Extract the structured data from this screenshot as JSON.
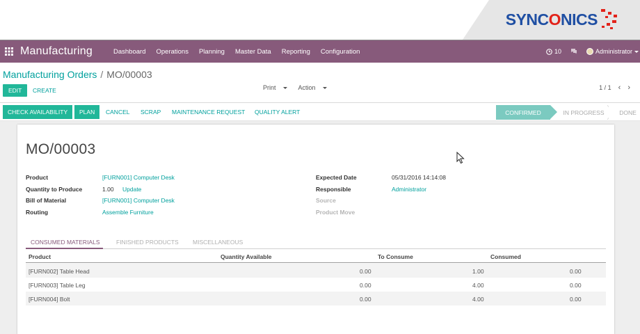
{
  "brand": {
    "text_before": "SYNC",
    "text_o": "O",
    "text_after": "NICS",
    "colors": {
      "blue": "#1f4fa3",
      "red": "#e2231a"
    }
  },
  "navbar": {
    "app_name": "Manufacturing",
    "menu": [
      "Dashboard",
      "Operations",
      "Planning",
      "Master Data",
      "Reporting",
      "Configuration"
    ],
    "activity_count": "10",
    "user": "Administrator",
    "color": "#875a7b"
  },
  "breadcrumb": {
    "parent": "Manufacturing Orders",
    "separator": "/",
    "current": "MO/00003"
  },
  "toolbar": {
    "edit_label": "EDIT",
    "create_label": "CREATE",
    "print_label": "Print",
    "action_label": "Action",
    "pager_text": "1 / 1"
  },
  "statusbar": {
    "buttons": {
      "check_availability": "CHECK AVAILABILITY",
      "plan": "PLAN",
      "cancel": "CANCEL",
      "scrap": "SCRAP",
      "maintenance_request": "MAINTENANCE REQUEST",
      "quality_alert": "QUALITY ALERT"
    },
    "stages": [
      "CONFIRMED",
      "IN PROGRESS",
      "DONE"
    ],
    "active_stage": "CONFIRMED"
  },
  "form": {
    "title": "MO/00003",
    "left": {
      "product_label": "Product",
      "product_value": "[FURN001] Computer Desk",
      "qty_label": "Quantity to Produce",
      "qty_value": "1.00",
      "qty_update": "Update",
      "bom_label": "Bill of Material",
      "bom_value": "[FURN001] Computer Desk",
      "routing_label": "Routing",
      "routing_value": "Assemble Furniture"
    },
    "right": {
      "date_label": "Expected Date",
      "date_value": "05/31/2016 14:14:08",
      "responsible_label": "Responsible",
      "responsible_value": "Administrator",
      "source_label": "Source",
      "product_move_label": "Product Move"
    }
  },
  "tabs": [
    "CONSUMED MATERIALS",
    "FINISHED PRODUCTS",
    "MISCELLANEOUS"
  ],
  "table": {
    "headers": [
      "Product",
      "Quantity Available",
      "To Consume",
      "Consumed"
    ],
    "rows": [
      {
        "product": "[FURN002] Table Head",
        "available": "0.00",
        "to_consume": "1.00",
        "consumed": "0.00"
      },
      {
        "product": "[FURN003] Table Leg",
        "available": "0.00",
        "to_consume": "4.00",
        "consumed": "0.00"
      },
      {
        "product": "[FURN004] Bolt",
        "available": "0.00",
        "to_consume": "4.00",
        "consumed": "0.00"
      }
    ]
  }
}
